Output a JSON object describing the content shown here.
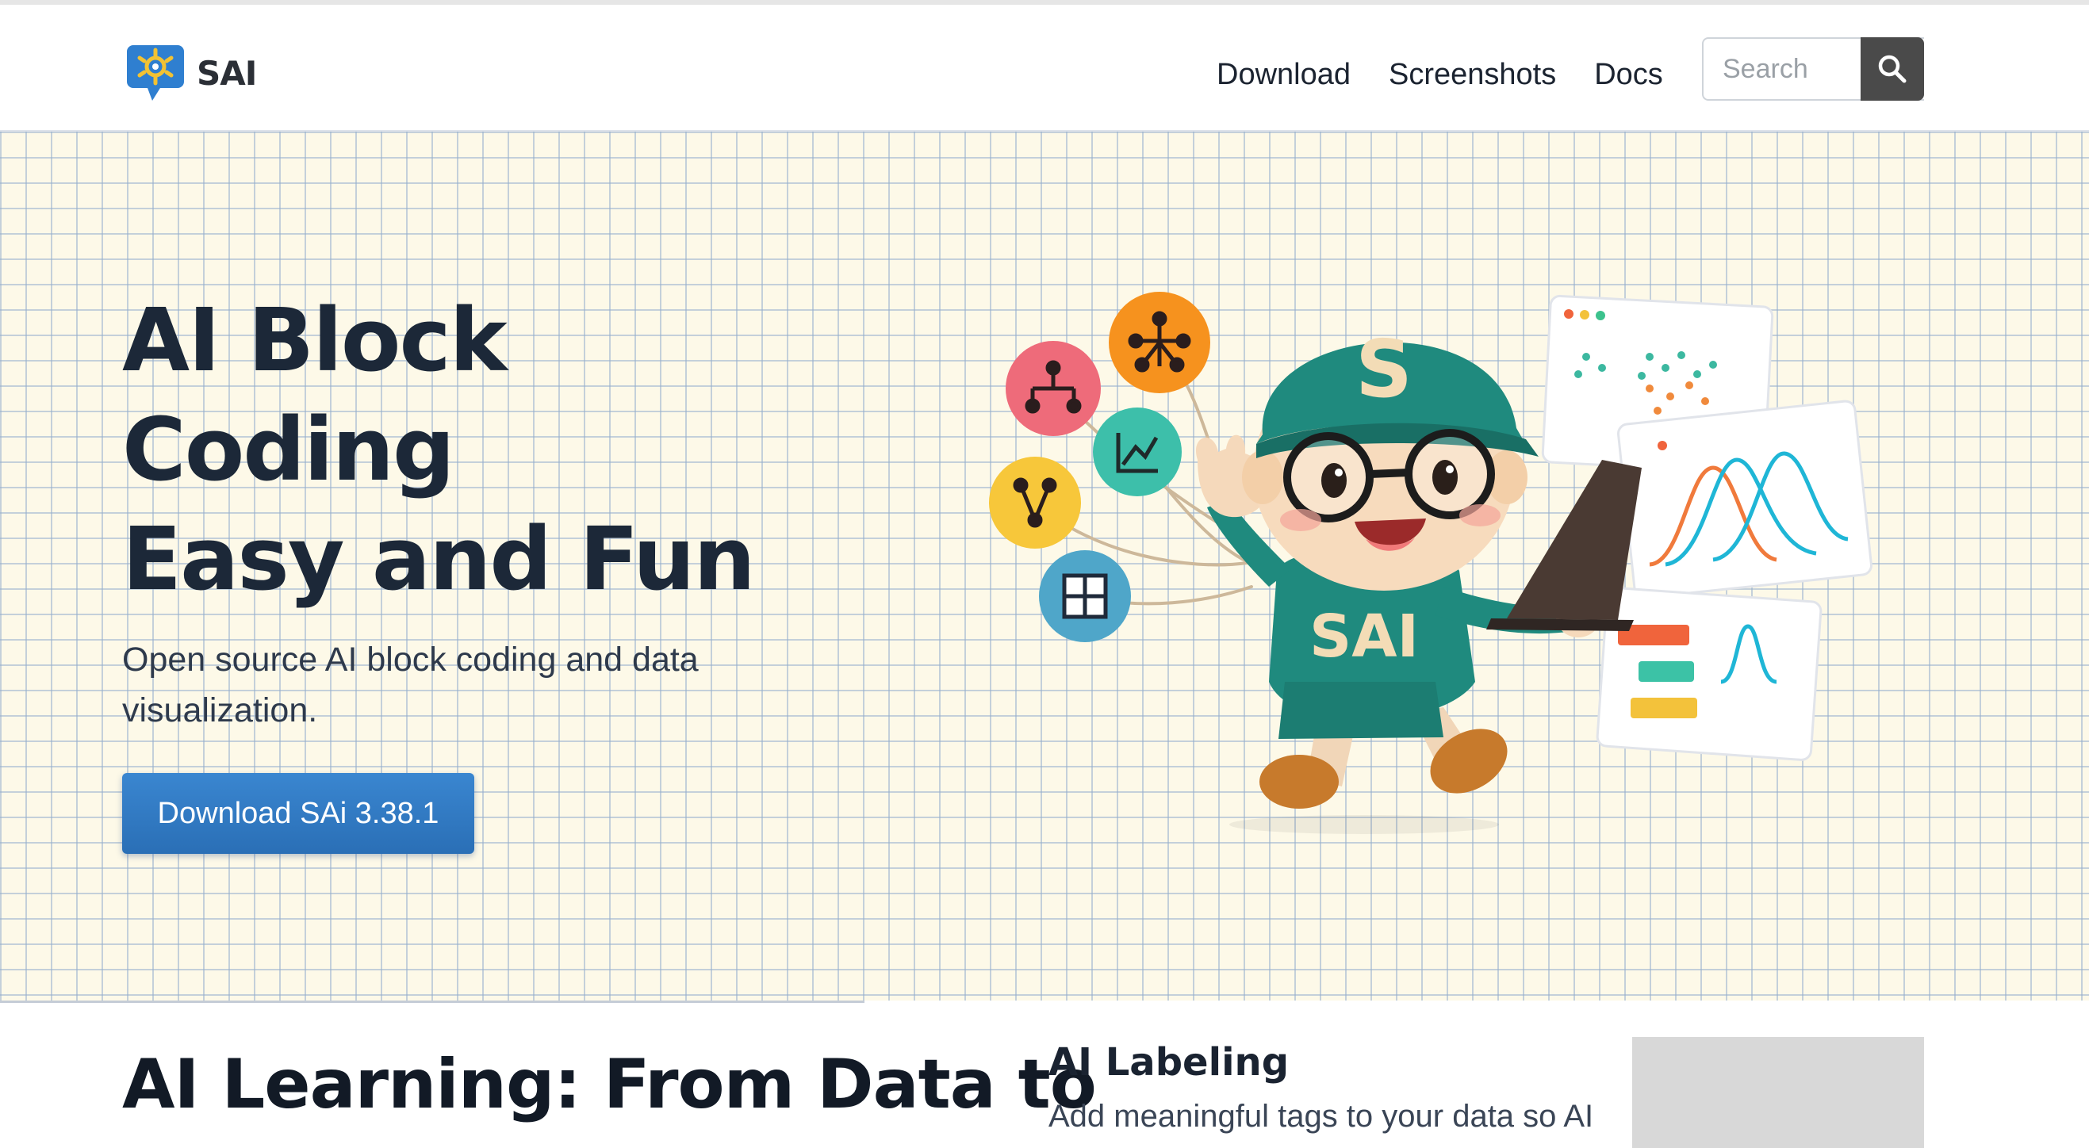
{
  "header": {
    "brand": "SAI",
    "nav": [
      {
        "label": "Download"
      },
      {
        "label": "Screenshots"
      },
      {
        "label": "Docs"
      }
    ],
    "search": {
      "placeholder": "Search"
    }
  },
  "hero": {
    "title_lines": [
      "AI Block",
      "Coding",
      "Easy and Fun"
    ],
    "subtitle": "Open source AI block coding and data visualization.",
    "cta_label": "Download SAi 3.38.1",
    "illustration": {
      "cap_letter": "S",
      "shirt_text": "SAI",
      "icons": [
        "hierarchy-icon",
        "network-icon",
        "fork-icon",
        "chart-icon",
        "grid-icon"
      ]
    }
  },
  "section": {
    "title": "AI Learning: From Data to",
    "feature": {
      "title": "AI Labeling",
      "text": "Add meaningful tags to your data so AI"
    }
  },
  "colors": {
    "primary": "#2f78c2",
    "hero_bg": "#fdf9e8",
    "text_dark": "#1c2838"
  }
}
